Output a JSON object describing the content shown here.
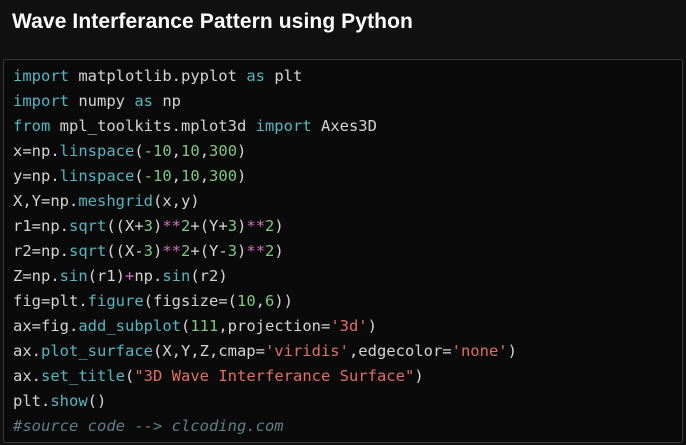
{
  "header": {
    "title": "Wave Interferance Pattern using Python"
  },
  "colors": {
    "background": "#111111",
    "code_background": "#0a0a0a",
    "keyword": "#56b6c2",
    "number": "#7ec97e",
    "operator": "#d070c0",
    "string": "#e07060",
    "comment": "#5f7f85",
    "text": "#d4d4d4"
  },
  "code": {
    "lines": [
      [
        {
          "t": "import",
          "c": "kw"
        },
        {
          "t": " matplotlib.pyplot ",
          "c": "txt"
        },
        {
          "t": "as",
          "c": "kw"
        },
        {
          "t": " plt",
          "c": "txt"
        }
      ],
      [
        {
          "t": "import",
          "c": "kw"
        },
        {
          "t": " numpy ",
          "c": "txt"
        },
        {
          "t": "as",
          "c": "kw"
        },
        {
          "t": " np",
          "c": "txt"
        }
      ],
      [
        {
          "t": "from",
          "c": "kw"
        },
        {
          "t": " mpl_toolkits.mplot3d ",
          "c": "txt"
        },
        {
          "t": "import",
          "c": "kw"
        },
        {
          "t": " Axes3D",
          "c": "txt"
        }
      ],
      [
        {
          "t": "x=np.",
          "c": "txt"
        },
        {
          "t": "linspace",
          "c": "fn"
        },
        {
          "t": "(",
          "c": "txt"
        },
        {
          "t": "-10",
          "c": "num"
        },
        {
          "t": ",",
          "c": "txt"
        },
        {
          "t": "10",
          "c": "num"
        },
        {
          "t": ",",
          "c": "txt"
        },
        {
          "t": "300",
          "c": "num"
        },
        {
          "t": ")",
          "c": "txt"
        }
      ],
      [
        {
          "t": "y=np.",
          "c": "txt"
        },
        {
          "t": "linspace",
          "c": "fn"
        },
        {
          "t": "(",
          "c": "txt"
        },
        {
          "t": "-10",
          "c": "num"
        },
        {
          "t": ",",
          "c": "txt"
        },
        {
          "t": "10",
          "c": "num"
        },
        {
          "t": ",",
          "c": "txt"
        },
        {
          "t": "300",
          "c": "num"
        },
        {
          "t": ")",
          "c": "txt"
        }
      ],
      [
        {
          "t": "X,Y=np.",
          "c": "txt"
        },
        {
          "t": "meshgrid",
          "c": "fn"
        },
        {
          "t": "(x,y)",
          "c": "txt"
        }
      ],
      [
        {
          "t": "r1=np.",
          "c": "txt"
        },
        {
          "t": "sqrt",
          "c": "fn"
        },
        {
          "t": "((X+",
          "c": "txt"
        },
        {
          "t": "3",
          "c": "num"
        },
        {
          "t": ")",
          "c": "txt"
        },
        {
          "t": "**",
          "c": "op"
        },
        {
          "t": "2",
          "c": "num"
        },
        {
          "t": "+(Y+",
          "c": "txt"
        },
        {
          "t": "3",
          "c": "num"
        },
        {
          "t": ")",
          "c": "txt"
        },
        {
          "t": "**",
          "c": "op"
        },
        {
          "t": "2",
          "c": "num"
        },
        {
          "t": ")",
          "c": "txt"
        }
      ],
      [
        {
          "t": "r2=np.",
          "c": "txt"
        },
        {
          "t": "sqrt",
          "c": "fn"
        },
        {
          "t": "((X-",
          "c": "txt"
        },
        {
          "t": "3",
          "c": "num"
        },
        {
          "t": ")",
          "c": "txt"
        },
        {
          "t": "**",
          "c": "op"
        },
        {
          "t": "2",
          "c": "num"
        },
        {
          "t": "+(Y-",
          "c": "txt"
        },
        {
          "t": "3",
          "c": "num"
        },
        {
          "t": ")",
          "c": "txt"
        },
        {
          "t": "**",
          "c": "op"
        },
        {
          "t": "2",
          "c": "num"
        },
        {
          "t": ")",
          "c": "txt"
        }
      ],
      [
        {
          "t": "Z=np.",
          "c": "txt"
        },
        {
          "t": "sin",
          "c": "fn"
        },
        {
          "t": "(r1)",
          "c": "txt"
        },
        {
          "t": "+",
          "c": "op"
        },
        {
          "t": "np.",
          "c": "txt"
        },
        {
          "t": "sin",
          "c": "fn"
        },
        {
          "t": "(r2)",
          "c": "txt"
        }
      ],
      [
        {
          "t": "fig=plt.",
          "c": "txt"
        },
        {
          "t": "figure",
          "c": "fn"
        },
        {
          "t": "(figsize=(",
          "c": "txt"
        },
        {
          "t": "10",
          "c": "num"
        },
        {
          "t": ",",
          "c": "txt"
        },
        {
          "t": "6",
          "c": "num"
        },
        {
          "t": "))",
          "c": "txt"
        }
      ],
      [
        {
          "t": "ax=fig.",
          "c": "txt"
        },
        {
          "t": "add_subplot",
          "c": "fn"
        },
        {
          "t": "(",
          "c": "txt"
        },
        {
          "t": "111",
          "c": "num"
        },
        {
          "t": ",projection=",
          "c": "txt"
        },
        {
          "t": "'3d'",
          "c": "str"
        },
        {
          "t": ")",
          "c": "txt"
        }
      ],
      [
        {
          "t": "ax.",
          "c": "txt"
        },
        {
          "t": "plot_surface",
          "c": "fn"
        },
        {
          "t": "(X,Y,Z,cmap=",
          "c": "txt"
        },
        {
          "t": "'viridis'",
          "c": "str"
        },
        {
          "t": ",edgecolor=",
          "c": "txt"
        },
        {
          "t": "'none'",
          "c": "str"
        },
        {
          "t": ")",
          "c": "txt"
        }
      ],
      [
        {
          "t": "ax.",
          "c": "txt"
        },
        {
          "t": "set_title",
          "c": "fn"
        },
        {
          "t": "(",
          "c": "txt"
        },
        {
          "t": "\"3D Wave Interferance Surface\"",
          "c": "str"
        },
        {
          "t": ")",
          "c": "txt"
        }
      ],
      [
        {
          "t": "plt.",
          "c": "txt"
        },
        {
          "t": "show",
          "c": "fn"
        },
        {
          "t": "()",
          "c": "txt"
        }
      ],
      [
        {
          "t": "#source code --> clcoding.com",
          "c": "cmt"
        }
      ]
    ]
  }
}
